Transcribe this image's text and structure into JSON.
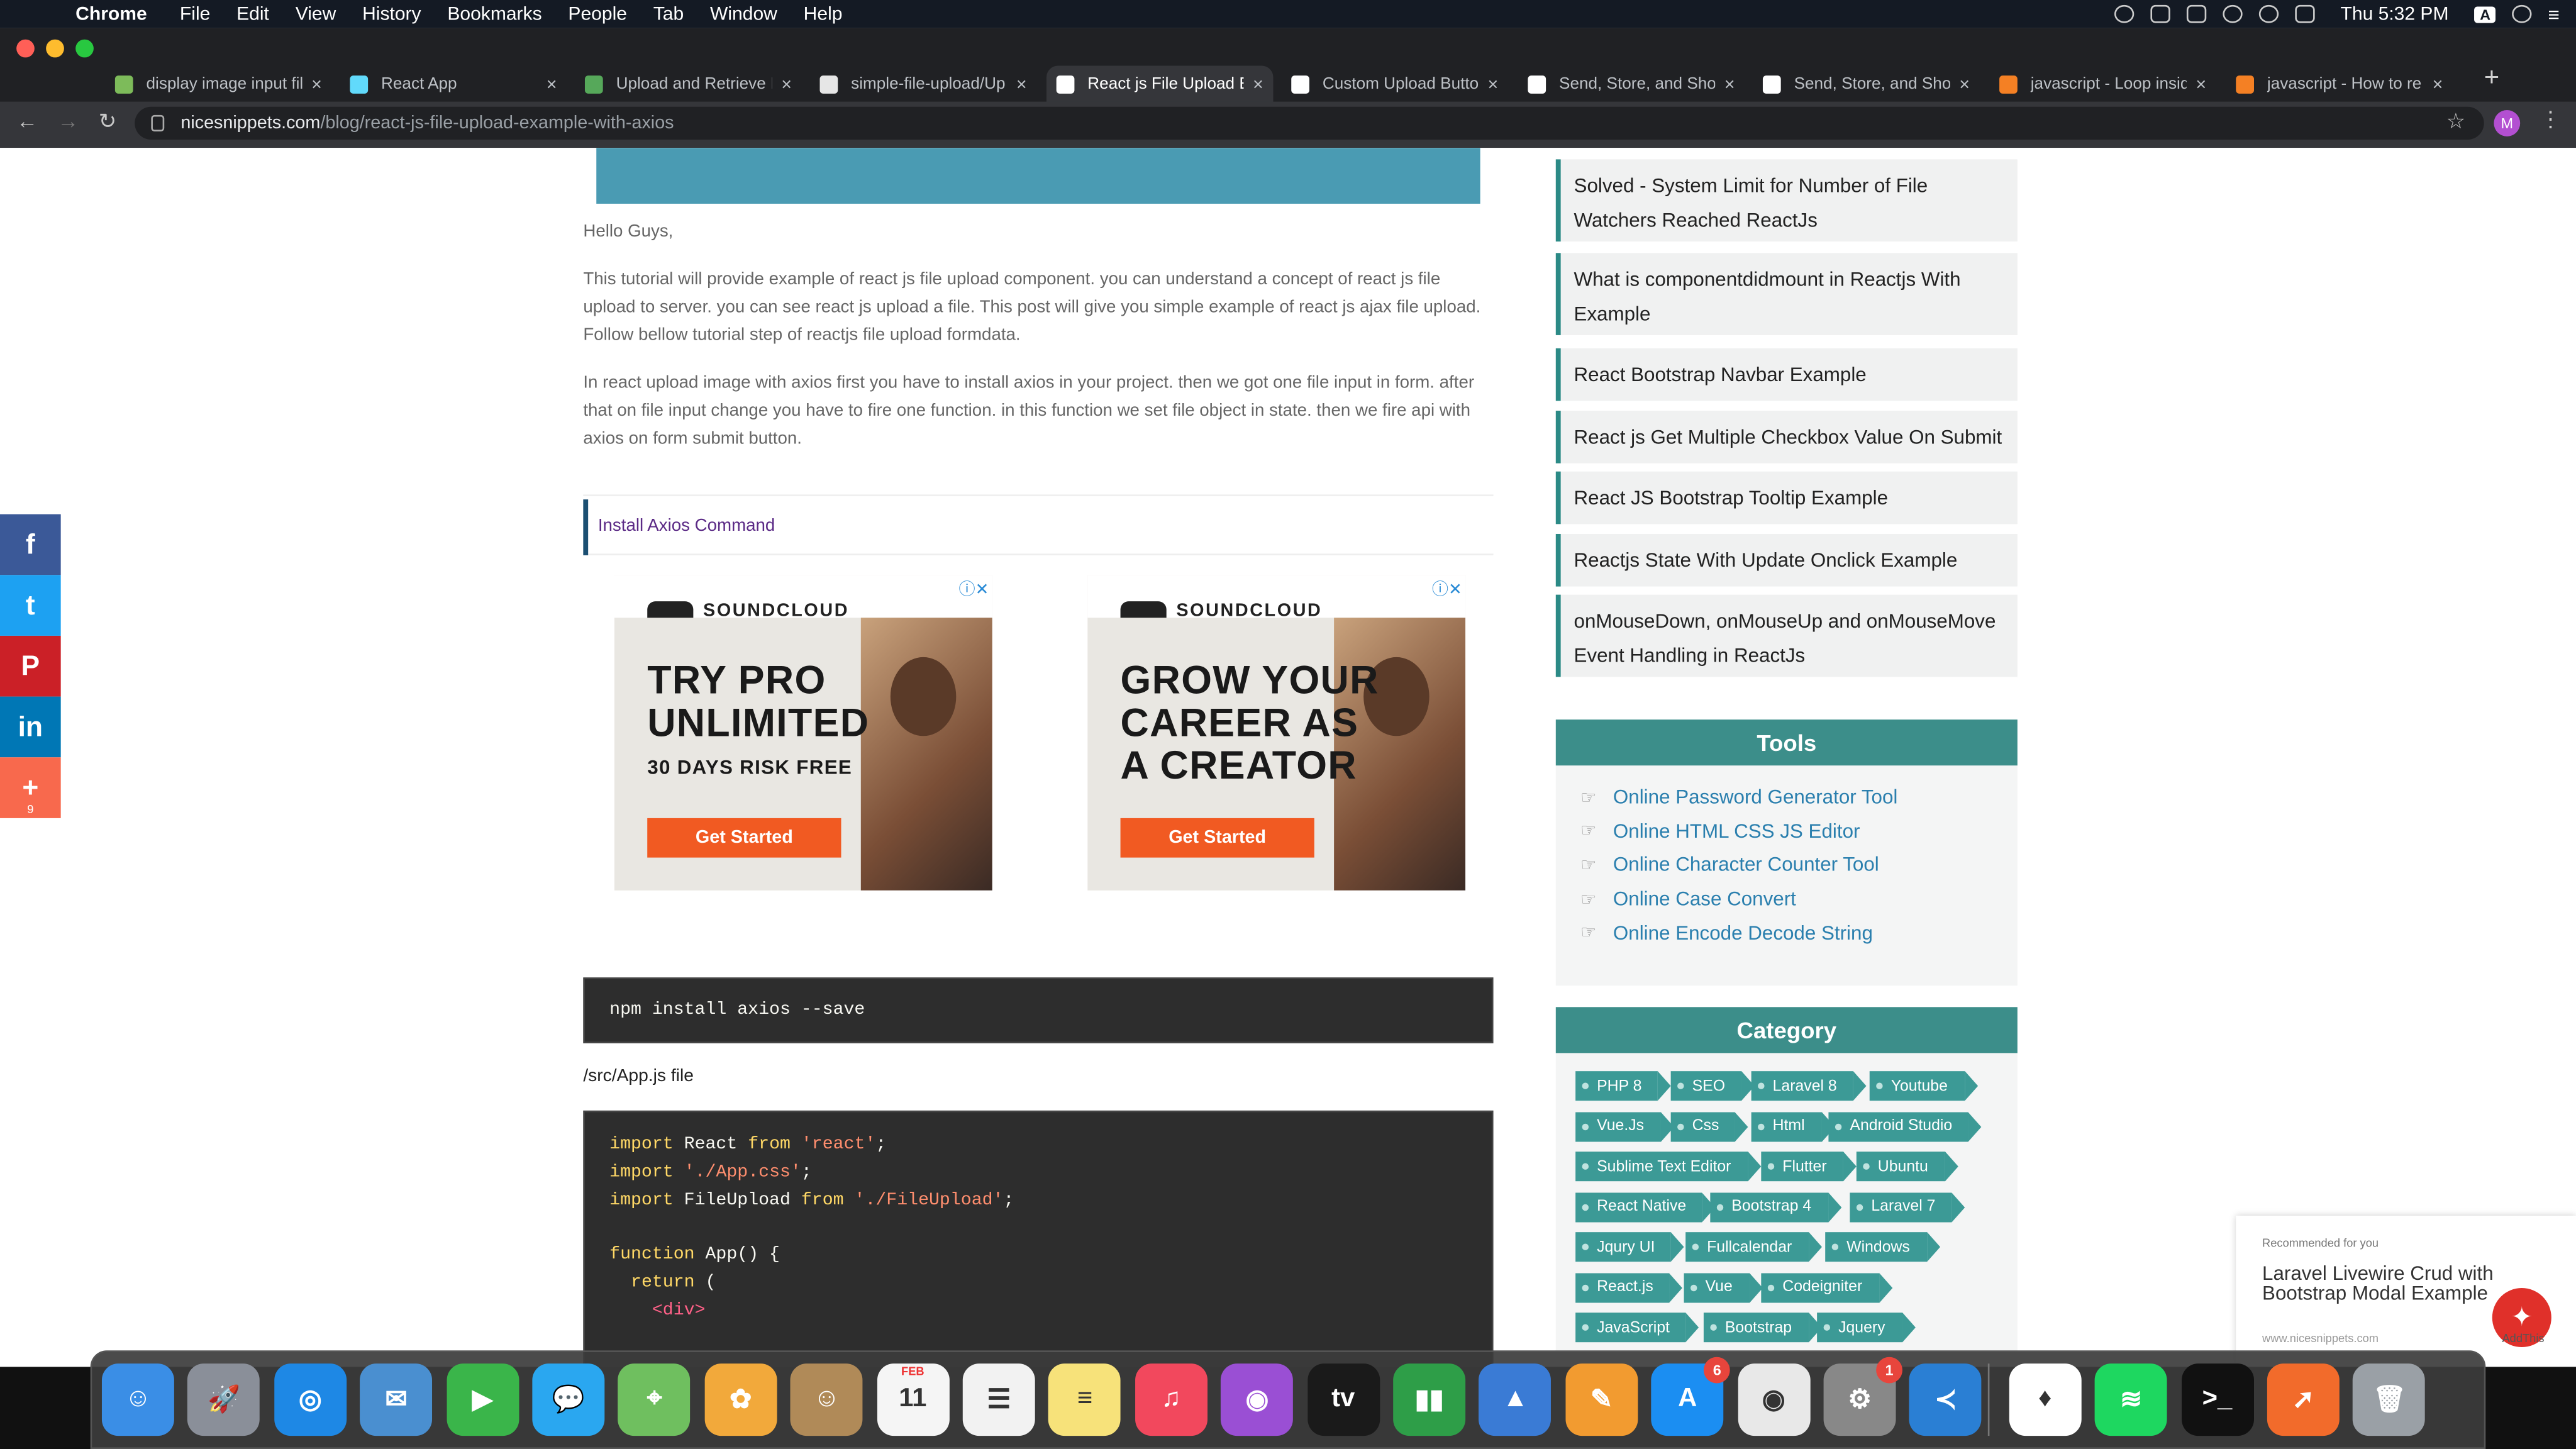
{
  "menubar": {
    "app": "Chrome",
    "items": [
      "File",
      "Edit",
      "View",
      "History",
      "Bookmarks",
      "People",
      "Tab",
      "Window",
      "Help"
    ],
    "clock": "Thu 5:32 PM",
    "input_source": "A"
  },
  "tabs": [
    {
      "title": "display image input fil",
      "icon": "search-icon",
      "color": "#7dbb5a"
    },
    {
      "title": "React App",
      "icon": "react-icon",
      "color": "#61dafb"
    },
    {
      "title": "Upload and Retrieve Ir",
      "icon": "link-icon",
      "color": "#56a85a"
    },
    {
      "title": "simple-file-upload/Up",
      "icon": "github-icon",
      "color": "#e6e6e6"
    },
    {
      "title": "React js File Upload E",
      "icon": "ns-icon",
      "color": "#ffffff"
    },
    {
      "title": "Custom Upload Butto",
      "icon": "medium-icon",
      "color": "#ffffff"
    },
    {
      "title": "Send, Store, and Show",
      "icon": "medium-icon",
      "color": "#ffffff"
    },
    {
      "title": "Send, Store, and Show",
      "icon": "medium-icon",
      "color": "#ffffff"
    },
    {
      "title": "javascript - Loop insid",
      "icon": "stackoverflow-icon",
      "color": "#f48024"
    },
    {
      "title": "javascript - How to re",
      "icon": "stackoverflow-icon",
      "color": "#f48024"
    }
  ],
  "active_tab": 4,
  "address": {
    "host": "nicesnippets.com",
    "path": "/blog/react-js-file-upload-example-with-axios",
    "avatar": "M"
  },
  "article": {
    "greeting": "Hello Guys,",
    "para1": "This tutorial will provide example of react js file upload component. you can understand a concept of react js file upload to server. you can see react js upload a file. This post will give you simple example of react js ajax file upload. Follow bellow tutorial step of reactjs file upload formdata.",
    "para2": "In react upload image with axios first you have to install axios in your project. then we got one file input in form. after that on file input change you have to fire one function. in this function we set file object in state. then we fire api with axios on form submit button.",
    "section_title": "Install Axios Command",
    "command": "npm install axios --save",
    "file_label": "/src/App.js file",
    "code_lines": [
      [
        {
          "t": "import",
          "c": "kw"
        },
        {
          "t": " React "
        },
        {
          "t": "from",
          "c": "kw"
        },
        {
          "t": " "
        },
        {
          "t": "'react'",
          "c": "st"
        },
        {
          "t": ";"
        }
      ],
      [
        {
          "t": "import",
          "c": "kw"
        },
        {
          "t": " "
        },
        {
          "t": "'./App.css'",
          "c": "st"
        },
        {
          "t": ";"
        }
      ],
      [
        {
          "t": "import",
          "c": "kw"
        },
        {
          "t": " FileUpload "
        },
        {
          "t": "from",
          "c": "kw"
        },
        {
          "t": " "
        },
        {
          "t": "'./FileUpload'",
          "c": "st"
        },
        {
          "t": ";"
        }
      ],
      [
        {
          "t": ""
        }
      ],
      [
        {
          "t": "function",
          "c": "kw"
        },
        {
          "t": " App() {"
        }
      ],
      [
        {
          "t": "  "
        },
        {
          "t": "return",
          "c": "kw"
        },
        {
          "t": " ("
        }
      ],
      [
        {
          "t": "    "
        },
        {
          "t": "<div>",
          "c": "tg"
        }
      ]
    ]
  },
  "ads": [
    {
      "brand": "SOUNDCLOUD",
      "headline": "TRY PRO UNLIMITED",
      "sub": "30 DAYS RISK FREE",
      "cta": "Get Started"
    },
    {
      "brand": "SOUNDCLOUD",
      "headline": "GROW YOUR CAREER AS A CREATOR",
      "sub": "",
      "cta": "Get Started"
    }
  ],
  "sidebar": {
    "related": [
      "Solved - System Limit for Number of File Watchers Reached ReactJs",
      "What is componentdidmount in Reactjs With Example",
      "React Bootstrap Navbar Example",
      "React js Get Multiple Checkbox Value On Submit",
      "React JS Bootstrap Tooltip Example",
      "Reactjs State With Update Onclick Example",
      "onMouseDown, onMouseUp and onMouseMove Event Handling in ReactJs"
    ],
    "tools_title": "Tools",
    "tools": [
      "Online Password Generator Tool",
      "Online HTML CSS JS Editor",
      "Online Character Counter Tool",
      "Online Case Convert",
      "Online Encode Decode String"
    ],
    "category_title": "Category",
    "categories": [
      [
        "PHP 8",
        "SEO",
        "Laravel 8",
        "Youtube"
      ],
      [
        "Vue.Js",
        "Css",
        "Html",
        "Android Studio"
      ],
      [
        "Sublime Text Editor",
        "Flutter",
        "Ubuntu"
      ],
      [
        "React Native",
        "Bootstrap 4",
        "Laravel 7"
      ],
      [
        "Jqury UI",
        "Fullcalendar",
        "Windows"
      ],
      [
        "React.js",
        "Vue",
        "Codeigniter"
      ],
      [
        "JavaScript",
        "Bootstrap",
        "Jquery"
      ]
    ]
  },
  "social": [
    {
      "name": "facebook",
      "glyph": "f",
      "color": "#3b5998"
    },
    {
      "name": "twitter",
      "glyph": "t",
      "color": "#1da1f2"
    },
    {
      "name": "pinterest",
      "glyph": "P",
      "color": "#cb2027"
    },
    {
      "name": "linkedin",
      "glyph": "in",
      "color": "#0077b5"
    },
    {
      "name": "more",
      "glyph": "+",
      "color": "#f8694d",
      "count": "9"
    }
  ],
  "recommend": {
    "label": "Recommended for you",
    "title": "Laravel Livewire Crud with Bootstrap Modal Example",
    "source": "www.nicesnippets.com",
    "addthis": "AddThis"
  },
  "dock": [
    {
      "name": "finder",
      "glyph": "☺",
      "color": "#3a8ee6"
    },
    {
      "name": "launchpad",
      "glyph": "🚀",
      "color": "#8a8f99"
    },
    {
      "name": "safari",
      "glyph": "◎",
      "color": "#1e88e5"
    },
    {
      "name": "preview",
      "glyph": "✉",
      "color": "#4a8fd0"
    },
    {
      "name": "facetime",
      "glyph": "▶",
      "color": "#3ab54a"
    },
    {
      "name": "messages",
      "glyph": "💬",
      "color": "#2aa7f0"
    },
    {
      "name": "maps",
      "glyph": "⌖",
      "color": "#6fbf5f"
    },
    {
      "name": "photos",
      "glyph": "✿",
      "color": "#f2a93b"
    },
    {
      "name": "contacts",
      "glyph": "☺",
      "color": "#b08a58"
    },
    {
      "name": "calendar",
      "glyph": "11",
      "color": "#f5f5f5",
      "sub": "FEB"
    },
    {
      "name": "reminders",
      "glyph": "☰",
      "color": "#f2f2f2"
    },
    {
      "name": "notes",
      "glyph": "≡",
      "color": "#f7e27a"
    },
    {
      "name": "music",
      "glyph": "♫",
      "color": "#f2485d"
    },
    {
      "name": "podcasts",
      "glyph": "◉",
      "color": "#9a4fd4"
    },
    {
      "name": "apple-tv",
      "glyph": "tv",
      "color": "#1a1a1a"
    },
    {
      "name": "numbers",
      "glyph": "▮▮",
      "color": "#2e9e48"
    },
    {
      "name": "keynote",
      "glyph": "▲",
      "color": "#3a7bd5"
    },
    {
      "name": "pages",
      "glyph": "✎",
      "color": "#f29b30"
    },
    {
      "name": "app-store",
      "glyph": "A",
      "color": "#1b8ef2",
      "badge": "6"
    },
    {
      "name": "chrome",
      "glyph": "◉",
      "color": "#e8e8e8"
    },
    {
      "name": "system-preferences",
      "glyph": "⚙",
      "color": "#888888",
      "badge": "1"
    },
    {
      "name": "vscode",
      "glyph": "≺",
      "color": "#2a7fd4"
    },
    {
      "name": "mongodb-compass",
      "glyph": "♦",
      "color": "#ffffff"
    },
    {
      "name": "spotify",
      "glyph": "≋",
      "color": "#1ed760"
    },
    {
      "name": "terminal",
      "glyph": ">_",
      "color": "#111111"
    },
    {
      "name": "postman",
      "glyph": "➚",
      "color": "#f26b2b"
    },
    {
      "name": "trash",
      "glyph": "🗑",
      "color": "#9aa0a6"
    }
  ]
}
